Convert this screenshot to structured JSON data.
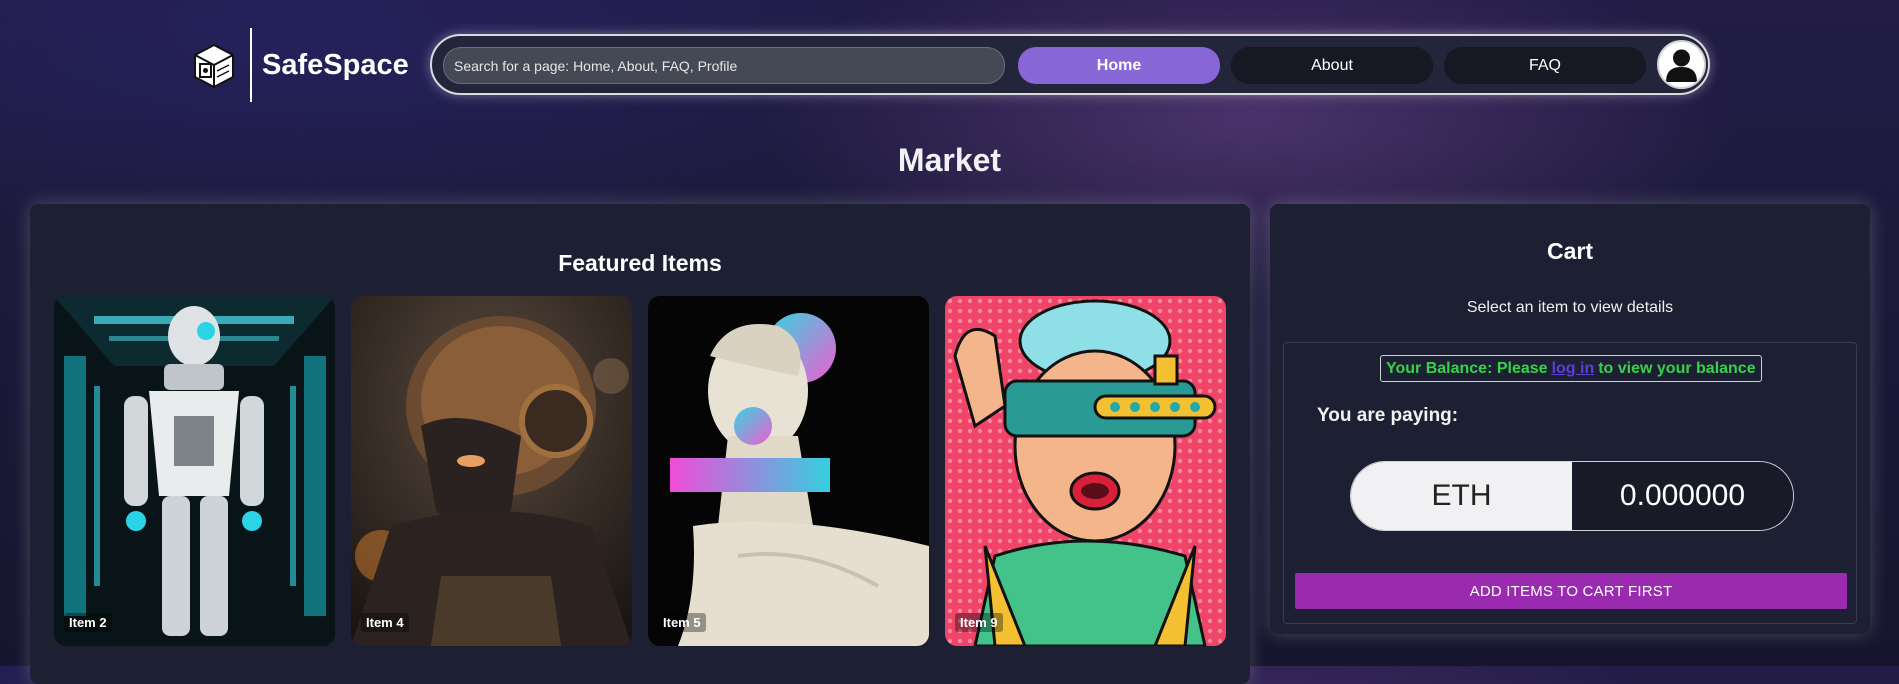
{
  "brand": {
    "name": "SafeSpace",
    "logo_icon": "safe-box-icon"
  },
  "navbar": {
    "search_placeholder": "Search for a page: Home, About, FAQ, Profile",
    "links": [
      {
        "label": "Home",
        "active": true
      },
      {
        "label": "About",
        "active": false
      },
      {
        "label": "FAQ",
        "active": false
      }
    ],
    "avatar_icon": "user-icon",
    "accent": "#8766d6"
  },
  "page": {
    "title": "Market"
  },
  "featured": {
    "title": "Featured Items",
    "items": [
      {
        "label": "Item 2",
        "image": "robot-in-corridor"
      },
      {
        "label": "Item 4",
        "image": "masked-figure-headphones"
      },
      {
        "label": "Item 5",
        "image": "greek-bust-glitch"
      },
      {
        "label": "Item 9",
        "image": "pop-art-vr-woman"
      }
    ]
  },
  "cart": {
    "title": "Cart",
    "subtitle": "Select an item to view details",
    "balance_prefix": "Your Balance: Please",
    "balance_link": "log in",
    "balance_suffix": "to view your balance",
    "paying_label": "You are paying:",
    "currency": "ETH",
    "amount": "0.000000",
    "button_label": "ADD ITEMS TO CART FIRST",
    "colors": {
      "balance_text": "#37d24a",
      "button": "#9a2bb0"
    }
  }
}
